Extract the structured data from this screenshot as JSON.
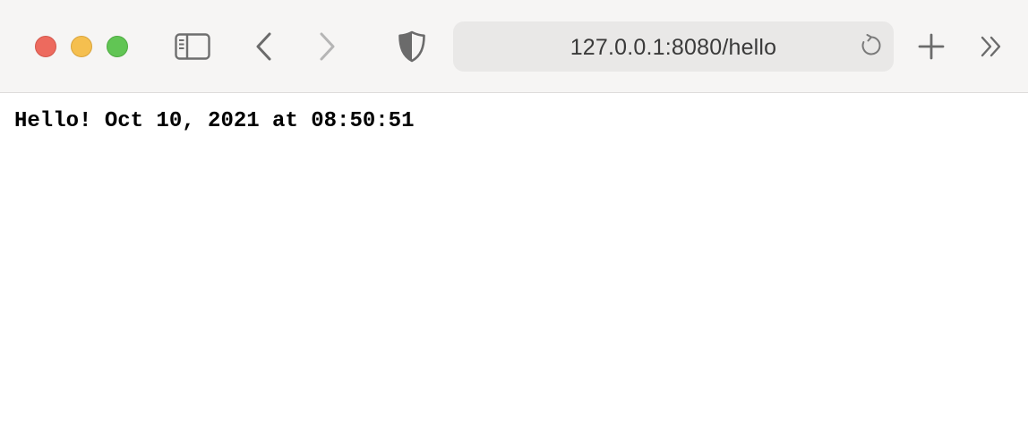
{
  "window": {
    "traffic_lights": {
      "close_color": "#ed6a5e",
      "minimize_color": "#f5bf4f",
      "zoom_color": "#61c554"
    }
  },
  "toolbar": {
    "icons": {
      "sidebar": "sidebar-icon",
      "back": "chevron-left-icon",
      "forward": "chevron-right-icon",
      "privacy": "shield-icon",
      "reload": "reload-icon",
      "new_tab": "plus-icon",
      "more": "double-chevron-right-icon"
    },
    "address_bar": {
      "url": "127.0.0.1:8080/hello"
    }
  },
  "page": {
    "body_text": "Hello! Oct 10, 2021 at 08:50:51"
  }
}
